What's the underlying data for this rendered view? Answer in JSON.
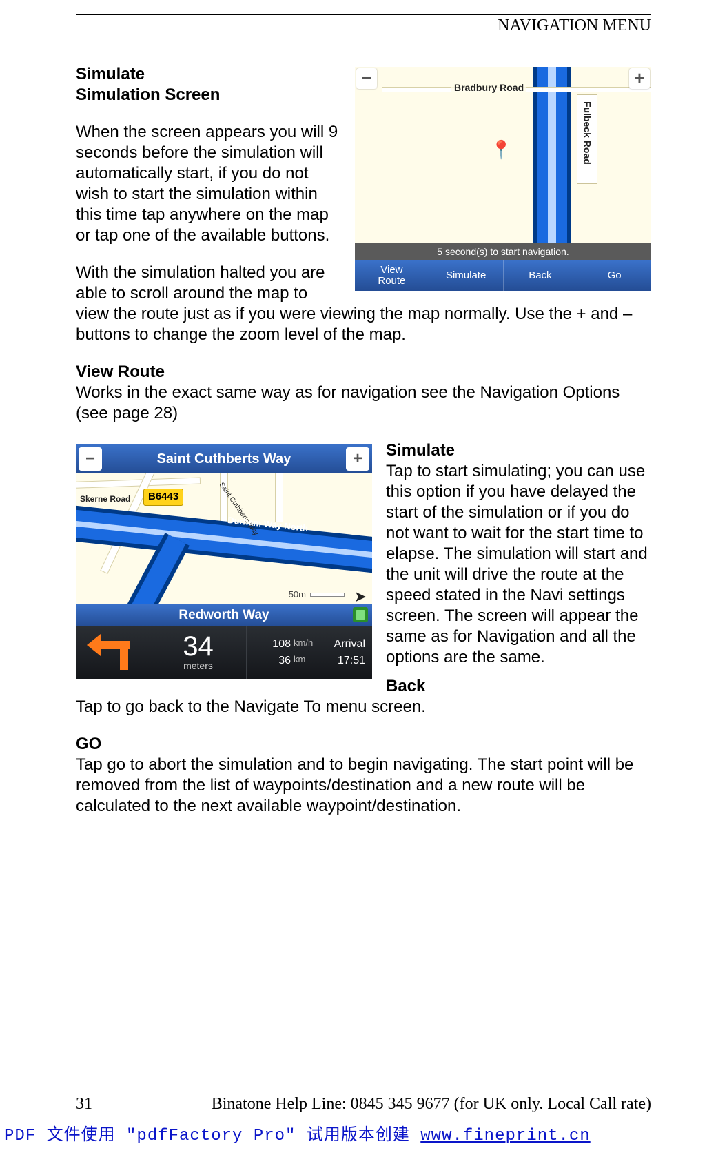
{
  "header": {
    "title": "NAVIGATION MENU"
  },
  "section1": {
    "title_line1": "Simulate",
    "title_line2": "Simulation Screen",
    "para1": "When the screen appears you will 9 seconds before the simulation will automatically start, if you do not wish to start the simulation within this time tap anywhere on the map or tap one of the available buttons.",
    "para2": "With the simulation halted you are able to scroll around the map to view the route just as if you were viewing the map normally. Use the + and – buttons to change the zoom level of the map."
  },
  "section2": {
    "title": "View Route",
    "para": "Works in the exact same way as for navigation see the Navigation Options (see page 28)"
  },
  "section3": {
    "title": "Simulate",
    "para": "Tap to start simulating; you can use this option if you have delayed the start of the simulation or if you do not want to wait for the start time to elapse.  The simulation will start and the unit will drive the route at the speed stated in the Navi settings screen. The screen will appear the same as for Navigation and all the options are the same."
  },
  "section4": {
    "title": "Back",
    "para": "Tap to go back to the Navigate To menu screen."
  },
  "section5": {
    "title": "GO",
    "para": "Tap go to abort the simulation and to begin navigating. The start point will be removed from the list of waypoints/destination and a new route will be calculated to the next available waypoint/destination."
  },
  "figA": {
    "road_h_label": "Bradbury Road",
    "side_road_label": "Fulbeck Road",
    "minus": "−",
    "plus": "+",
    "countdown": "5 second(s) to start navigation.",
    "buttons": {
      "view_route": "View\nRoute",
      "simulate": "Simulate",
      "back": "Back",
      "go": "Go"
    }
  },
  "figB": {
    "topbar_title": "Saint Cuthberts Way",
    "minus": "−",
    "plus": "+",
    "shield": "B6443",
    "skerne": "Skerne Road",
    "durham": "Durham Way North",
    "cuthberts": "Saint Cuthberts Way",
    "scale": "50m",
    "bluebar": "Redworth Way",
    "dist_num": "34",
    "dist_unit": "meters",
    "speed_val": "108",
    "speed_unit": "km/h",
    "arrival_label": "Arrival",
    "remain_val": "36",
    "remain_unit": "km",
    "arrival_time": "17:51"
  },
  "footer": {
    "page": "31",
    "helpline": "Binatone Help Line: 0845 345 9677 (for UK only. Local Call rate)"
  },
  "pdfnote": {
    "prefix": "PDF 文件使用 \"pdfFactory Pro\" 试用版本创建 ",
    "link": "www.fineprint.cn"
  }
}
